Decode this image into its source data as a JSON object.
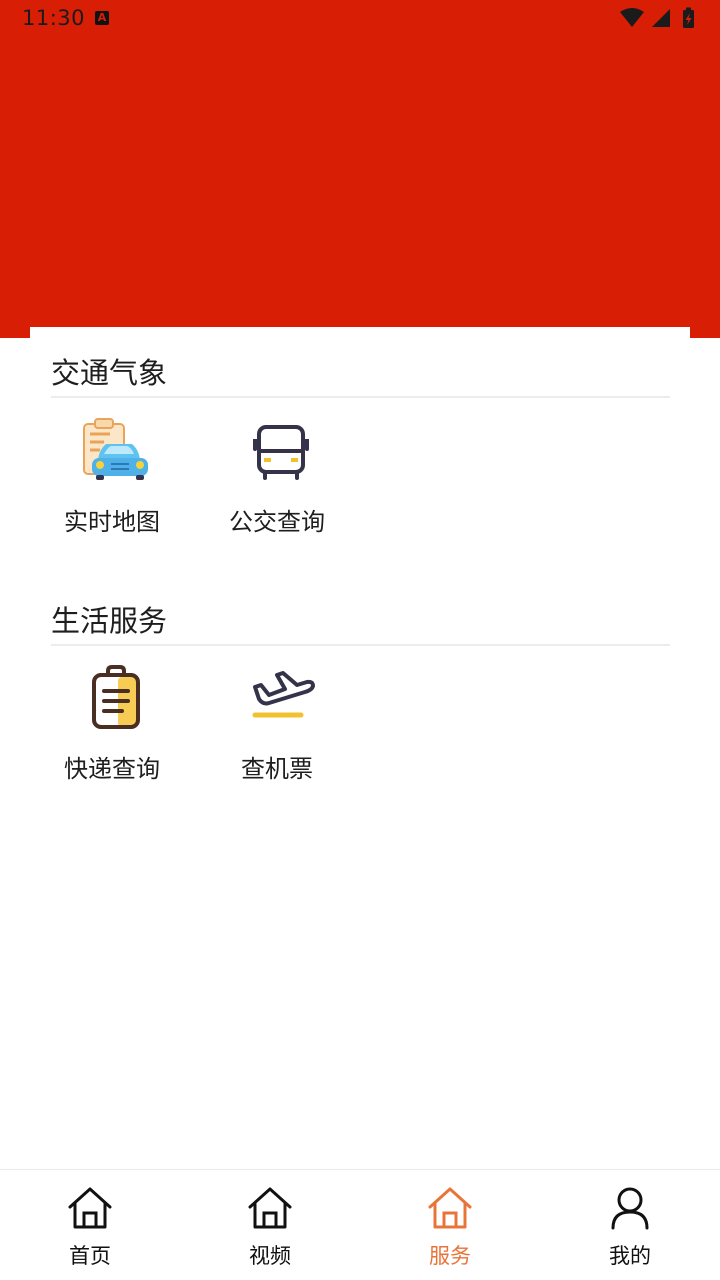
{
  "status_bar": {
    "time": "11:30",
    "notification_icon": "a-icon",
    "icons": [
      "wifi-icon",
      "signal-icon",
      "battery-charging-icon"
    ]
  },
  "colors": {
    "header_red": "#d81f06",
    "active_orange": "#e9743a",
    "icon_dark": "#34334a",
    "icon_yellow": "#f2c12e"
  },
  "sections": [
    {
      "title": "交通气象",
      "items": [
        {
          "label": "实时地图",
          "icon": "car-clipboard-icon"
        },
        {
          "label": "公交查询",
          "icon": "bus-icon"
        }
      ]
    },
    {
      "title": "生活服务",
      "items": [
        {
          "label": "快递查询",
          "icon": "clipboard-icon"
        },
        {
          "label": "查机票",
          "icon": "airplane-icon"
        }
      ]
    }
  ],
  "bottom_nav": [
    {
      "label": "首页",
      "icon": "home-icon",
      "active": false
    },
    {
      "label": "视频",
      "icon": "home-icon",
      "active": false
    },
    {
      "label": "服务",
      "icon": "home-icon",
      "active": true
    },
    {
      "label": "我的",
      "icon": "user-icon",
      "active": false
    }
  ]
}
